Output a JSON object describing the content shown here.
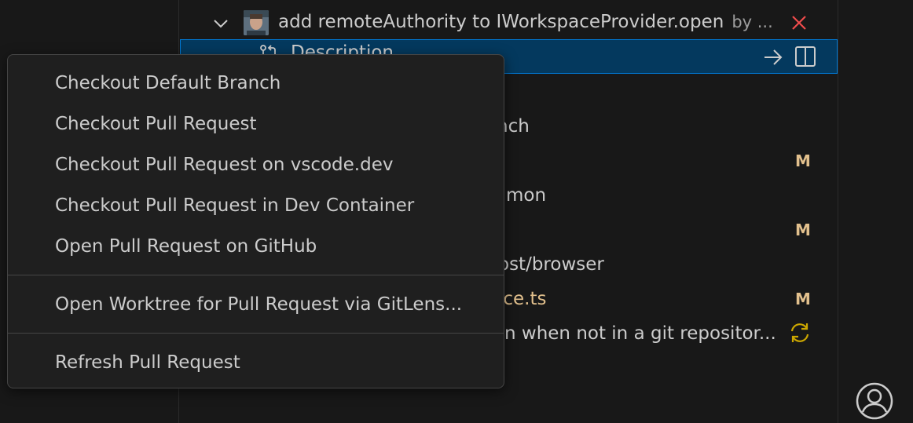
{
  "pr": {
    "title": "add remoteAuthority to IWorkspaceProvider.open",
    "author": "by ...",
    "description_label": "Description"
  },
  "tree_fragments": {
    "branch": "nch",
    "common": "mon",
    "browser_path": "ost/browser",
    "file_name": "ice.ts",
    "commit_msg": "n when not in a git repositor..."
  },
  "badges": {
    "modified": "M"
  },
  "context_menu": {
    "items": [
      "Checkout Default Branch",
      "Checkout Pull Request",
      "Checkout Pull Request on vscode.dev",
      "Checkout Pull Request in Dev Container",
      "Open Pull Request on GitHub"
    ],
    "gitlens_item": "Open Worktree for Pull Request via GitLens...",
    "refresh_item": "Refresh Pull Request"
  },
  "icons": {
    "chevron": "chevron-down-icon",
    "close": "close-icon",
    "description": "git-compare-icon",
    "arrow": "arrow-right-icon",
    "split": "split-editor-icon",
    "sync": "sync-icon",
    "account": "account-icon"
  },
  "colors": {
    "accent_blue": "#0078d4",
    "selection_bg": "#04395e",
    "modified": "#e2c08d",
    "close_red": "#f14c4c",
    "sync_yellow": "#cca700"
  }
}
